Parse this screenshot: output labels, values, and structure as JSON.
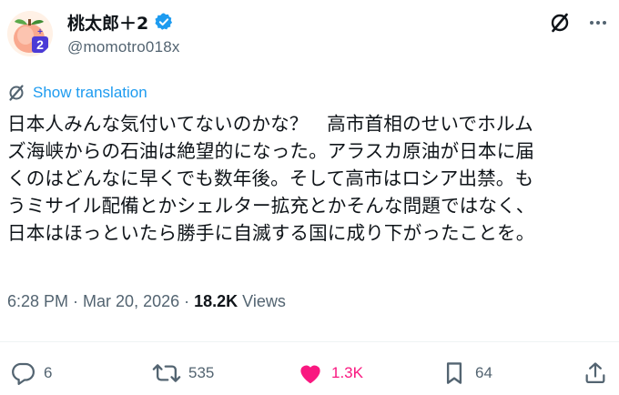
{
  "author": {
    "display_name": "桃太郎＋2",
    "handle": "@momotro018x",
    "verified_icon": "verified-badge-icon",
    "avatar_badge": "2"
  },
  "header_icons": [
    "grok-icon",
    "more-icon"
  ],
  "translation": {
    "label": "Show translation"
  },
  "tweet": {
    "lines": [
      "日本人みんな気付いてないのかな？　高市首相のせいでホルム",
      "ズ海峡からの石油は絶望的になった。アラスカ原油が日本に届",
      "くのはどんなに早くでも数年後。そして高市はロシア出禁。も",
      "うミサイル配備とかシェルター拡充とかそんな問題ではなく、",
      "日本はほっといたら勝手に自滅する国に成り下がったことを。"
    ]
  },
  "meta": {
    "time": "6:28 PM",
    "sep1": "·",
    "date": "Mar 20, 2026",
    "sep2": "·",
    "views_count": "18.2K",
    "views_label": "Views"
  },
  "actions": {
    "reply_count": "6",
    "repost_count": "535",
    "like_count": "1.3K",
    "bookmark_count": "64",
    "like_color": "#f91880"
  },
  "colors": {
    "accent": "#1d9bf0",
    "muted": "#536471",
    "text": "#0f1419",
    "like": "#f91880"
  }
}
